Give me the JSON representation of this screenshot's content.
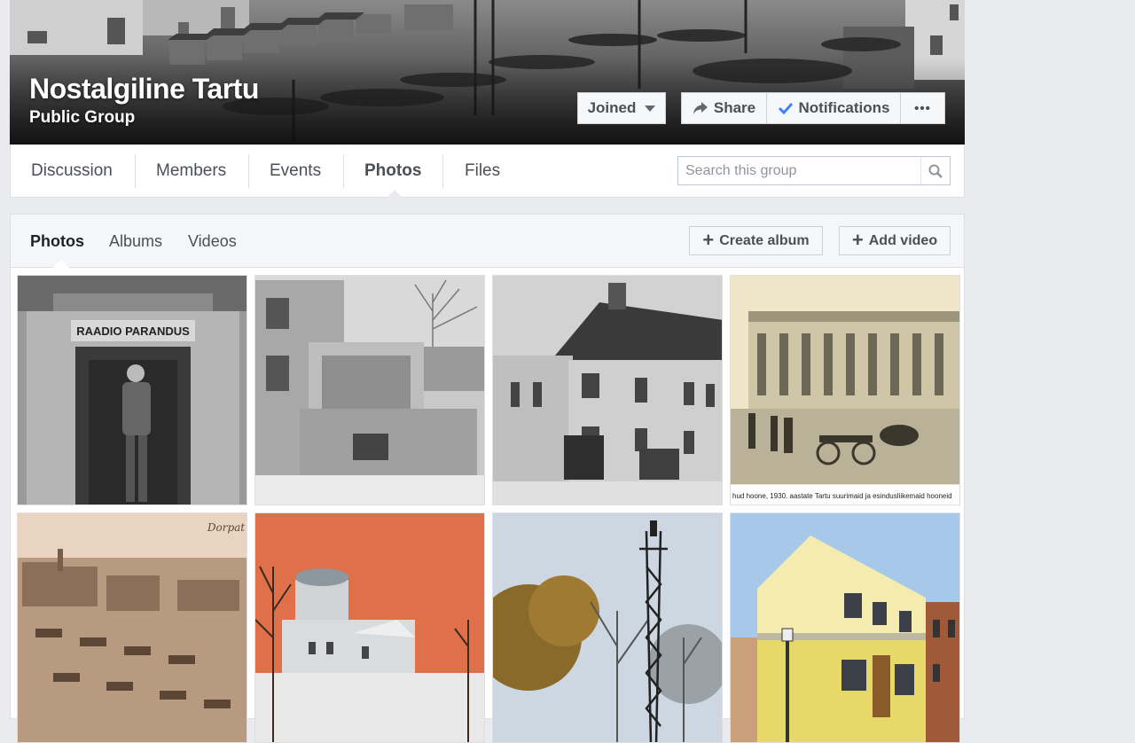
{
  "group": {
    "name": "Nostalgiline Tartu",
    "privacy": "Public Group"
  },
  "cover_actions": {
    "joined": "Joined",
    "share": "Share",
    "notifications": "Notifications",
    "more": "•••"
  },
  "nav": {
    "tabs": [
      "Discussion",
      "Members",
      "Events",
      "Photos",
      "Files"
    ],
    "active_tab": "Photos",
    "search_placeholder": "Search this group"
  },
  "photos_section": {
    "tabs": [
      "Photos",
      "Albums",
      "Videos"
    ],
    "active_tab": "Photos",
    "create_album": "Create album",
    "add_video": "Add video"
  },
  "photos": [
    {
      "sign_text": "RAADIO PARANDUS"
    },
    {},
    {},
    {
      "caption": "hud hoone, 1930. aastate Tartu suurimaid ja esindusliikemaid hooneid"
    },
    {
      "corner_text": "Dorpat"
    },
    {},
    {},
    {}
  ],
  "colors": {
    "page_bg": "#e9ebee",
    "accent_check": "#4080ff",
    "text_gray": "#4b4f56"
  }
}
